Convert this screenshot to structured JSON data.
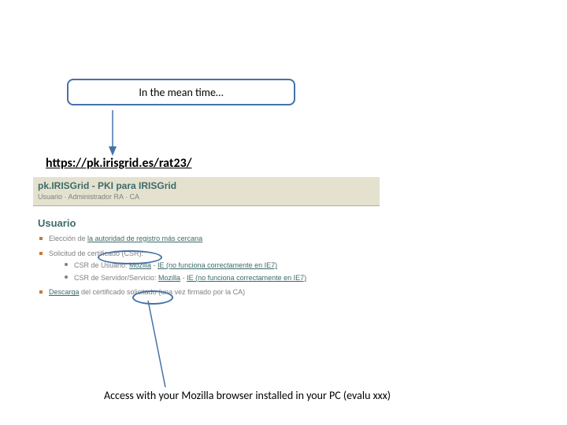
{
  "callout": {
    "text": "In the mean time…"
  },
  "url": {
    "text": "https://pk.irisgrid.es/rat23/"
  },
  "panel": {
    "title": "pk.IRISGrid - PKI para IRISGrid",
    "subnav": "Usuario · Administrador RA · CA",
    "section": "Usuario",
    "items": {
      "eleccion": {
        "pre": "Elección de ",
        "link": "la autoridad de registro más cercana"
      },
      "solicitud": {
        "label": "Solicitud de certificado (CSR):",
        "sub1": {
          "pre": "CSR de Usuario: ",
          "link": "Mozilla",
          "mid": " - ",
          "link2": "IE (no funciona correctamente en IE7)"
        },
        "sub2": {
          "pre": "CSR de Servidor/Servicio: ",
          "link": "Mozilla",
          "mid": " - ",
          "link2": "IE (no funciona correctamente en IE7)"
        }
      },
      "descarga": {
        "link": "Descarga",
        "post": " del certificado solicitado (una vez firmado por la CA)"
      }
    }
  },
  "caption": {
    "text": "Access with your Mozilla browser installed in your PC (evalu xxx)"
  }
}
